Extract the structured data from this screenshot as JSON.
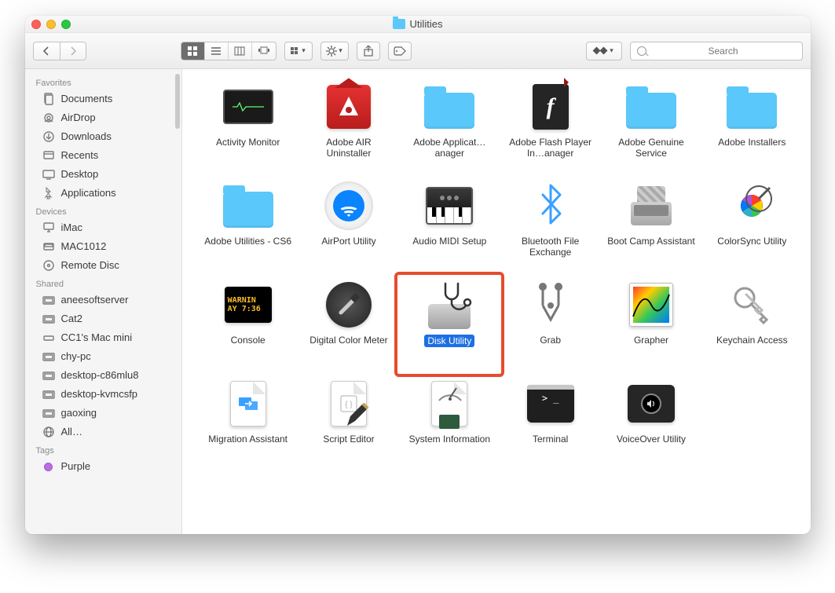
{
  "window": {
    "title": "Utilities"
  },
  "toolbar": {
    "search_placeholder": "Search"
  },
  "sidebar": {
    "sections": [
      {
        "title": "Favorites",
        "items": [
          {
            "icon": "documents",
            "label": "Documents"
          },
          {
            "icon": "airdrop",
            "label": "AirDrop"
          },
          {
            "icon": "downloads",
            "label": "Downloads"
          },
          {
            "icon": "recents",
            "label": "Recents"
          },
          {
            "icon": "desktop",
            "label": "Desktop"
          },
          {
            "icon": "applications",
            "label": "Applications"
          }
        ]
      },
      {
        "title": "Devices",
        "items": [
          {
            "icon": "imac",
            "label": "iMac"
          },
          {
            "icon": "disk",
            "label": "MAC1012"
          },
          {
            "icon": "disc",
            "label": "Remote Disc"
          }
        ]
      },
      {
        "title": "Shared",
        "items": [
          {
            "icon": "net",
            "label": "aneesoftserver"
          },
          {
            "icon": "net",
            "label": "Cat2"
          },
          {
            "icon": "macmini",
            "label": "CC1's Mac mini"
          },
          {
            "icon": "net",
            "label": "chy-pc"
          },
          {
            "icon": "net",
            "label": "desktop-c86mlu8"
          },
          {
            "icon": "net",
            "label": "desktop-kvmcsfp"
          },
          {
            "icon": "net",
            "label": "gaoxing"
          },
          {
            "icon": "globe",
            "label": "All…"
          }
        ]
      },
      {
        "title": "Tags",
        "items": [
          {
            "icon": "tag-purple",
            "label": "Purple"
          }
        ]
      }
    ]
  },
  "apps": [
    {
      "label": "Activity Monitor",
      "kind": "monitor"
    },
    {
      "label": "Adobe AIR Uninstaller",
      "kind": "air"
    },
    {
      "label": "Adobe Applicat…anager",
      "kind": "folder"
    },
    {
      "label": "Adobe Flash Player In…anager",
      "kind": "flash"
    },
    {
      "label": "Adobe Genuine Service",
      "kind": "folder"
    },
    {
      "label": "Adobe Installers",
      "kind": "folder"
    },
    {
      "label": "Adobe Utilities - CS6",
      "kind": "folder"
    },
    {
      "label": "AirPort Utility",
      "kind": "airport"
    },
    {
      "label": "Audio MIDI Setup",
      "kind": "piano"
    },
    {
      "label": "Bluetooth File Exchange",
      "kind": "bluetooth"
    },
    {
      "label": "Boot Camp Assistant",
      "kind": "bootcamp"
    },
    {
      "label": "ColorSync Utility",
      "kind": "colorsync"
    },
    {
      "label": "Console",
      "kind": "console"
    },
    {
      "label": "Digital Color Meter",
      "kind": "colormeter"
    },
    {
      "label": "Disk Utility",
      "kind": "diskutil",
      "selected": true,
      "highlighted": true
    },
    {
      "label": "Grab",
      "kind": "grab"
    },
    {
      "label": "Grapher",
      "kind": "grapher"
    },
    {
      "label": "Keychain Access",
      "kind": "keychain"
    },
    {
      "label": "Migration Assistant",
      "kind": "migration"
    },
    {
      "label": "Script Editor",
      "kind": "scripted"
    },
    {
      "label": "System Information",
      "kind": "sysinfo"
    },
    {
      "label": "Terminal",
      "kind": "terminal"
    },
    {
      "label": "VoiceOver Utility",
      "kind": "voiceover"
    }
  ],
  "console_text": {
    "line1": "WARNIN",
    "line2": "AY 7:36"
  }
}
